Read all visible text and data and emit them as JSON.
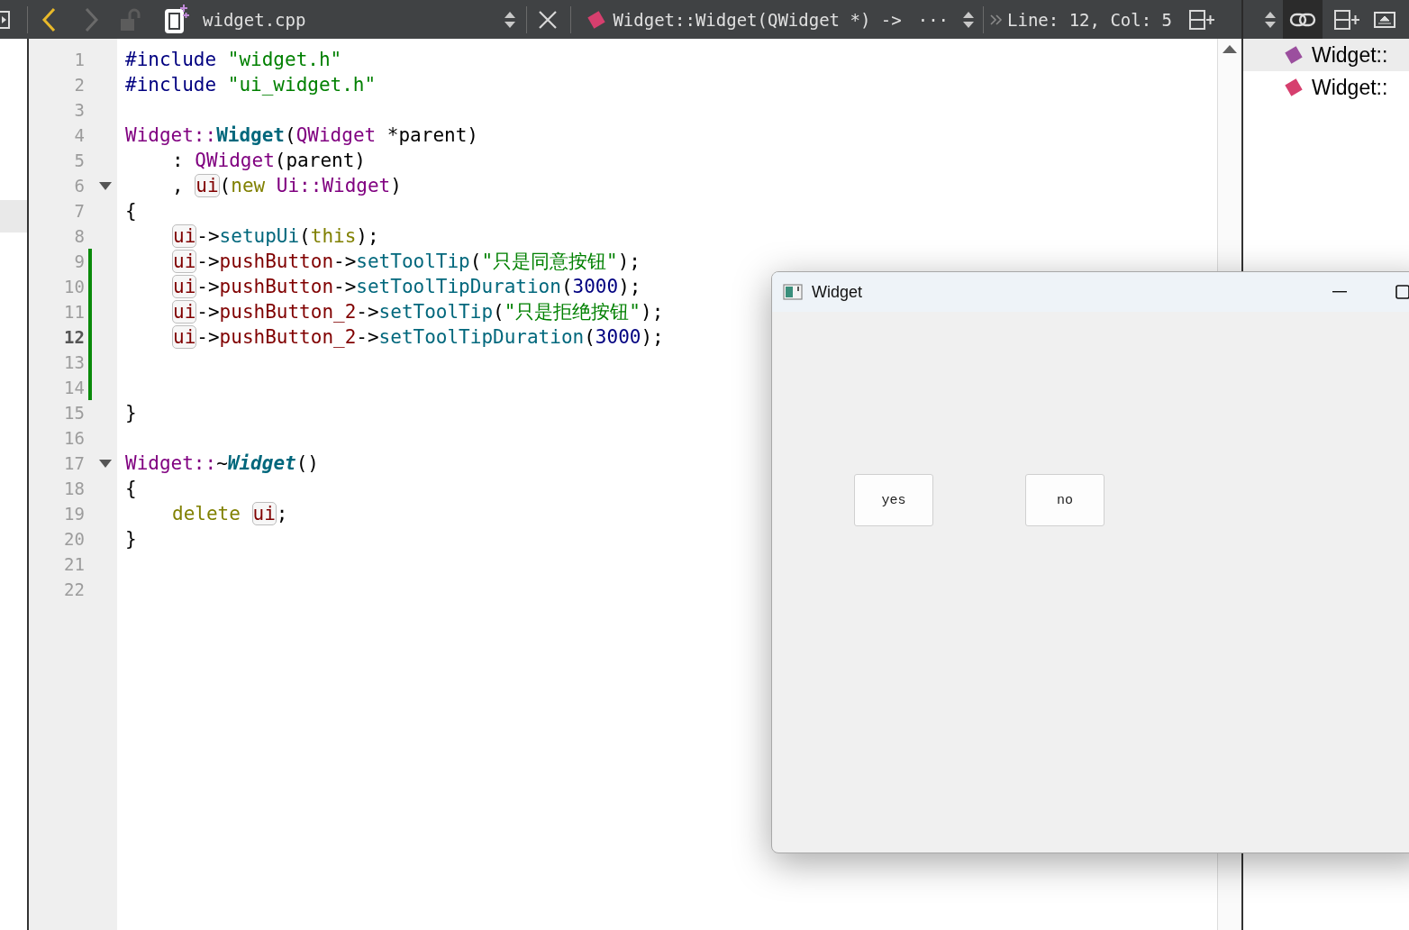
{
  "toolbar": {
    "back": {
      "disabled": false
    },
    "forward": {
      "disabled": true
    },
    "file_name": "widget.cpp",
    "symbol": "Widget::Widget(QWidget *) ->",
    "more": "···",
    "position": "Line: 12, Col: 5"
  },
  "outline_toolbar": {
    "link": {
      "selected": true
    }
  },
  "editor": {
    "lines": [
      {
        "number": "1",
        "current": false,
        "changed": false,
        "foldable": false,
        "tokens": [
          {
            "text": "#include ",
            "kind": "preproc"
          },
          {
            "text": "\"widget.h\"",
            "kind": "string"
          }
        ]
      },
      {
        "number": "2",
        "current": false,
        "changed": false,
        "foldable": false,
        "tokens": [
          {
            "text": "#include ",
            "kind": "preproc"
          },
          {
            "text": "\"ui_widget.h\"",
            "kind": "string"
          }
        ]
      },
      {
        "number": "3",
        "current": false,
        "changed": false,
        "foldable": false
      },
      {
        "number": "4",
        "current": false,
        "changed": false,
        "foldable": false,
        "tokens": [
          {
            "text": "Widget::",
            "kind": "type"
          },
          {
            "text": "Widget",
            "kind": "decl"
          },
          {
            "text": "(",
            "kind": "plain"
          },
          {
            "text": "QWidget",
            "kind": "type"
          },
          {
            "text": " *parent)",
            "kind": "plain"
          }
        ],
        "children": [
          {
            "number": "5",
            "current": false,
            "changed": false,
            "foldable": false,
            "tokens": [
              {
                "text": ": ",
                "kind": "plain"
              },
              {
                "text": "QWidget",
                "kind": "type"
              },
              {
                "text": "(parent)",
                "kind": "plain"
              }
            ]
          },
          {
            "number": "6",
            "current": false,
            "changed": false,
            "foldable": true,
            "tokens": [
              {
                "text": ", ",
                "kind": "plain"
              },
              {
                "text": "ui",
                "kind": "ref"
              },
              {
                "text": "(",
                "kind": "plain"
              },
              {
                "text": "new",
                "kind": "keyword"
              },
              {
                "text": " Ui::Widget",
                "kind": "type"
              },
              {
                "text": ")",
                "kind": "plain"
              }
            ]
          }
        ]
      },
      {
        "number": "7",
        "current": false,
        "changed": false,
        "foldable": false,
        "tokens": [
          {
            "text": "{",
            "kind": "plain"
          }
        ],
        "children": [
          {
            "number": "8",
            "current": false,
            "changed": false,
            "foldable": false,
            "tokens": [
              {
                "text": "ui",
                "kind": "ref"
              },
              {
                "text": "->",
                "kind": "plain"
              },
              {
                "text": "setupUi",
                "kind": "method"
              },
              {
                "text": "(",
                "kind": "plain"
              },
              {
                "text": "this",
                "kind": "keyword"
              },
              {
                "text": ");",
                "kind": "plain"
              }
            ]
          },
          {
            "number": "9",
            "current": false,
            "changed": true,
            "foldable": false,
            "tokens": [
              {
                "text": "ui",
                "kind": "ref"
              },
              {
                "text": "->",
                "kind": "plain"
              },
              {
                "text": "pushButton",
                "kind": "member"
              },
              {
                "text": "->",
                "kind": "plain"
              },
              {
                "text": "setToolTip",
                "kind": "method"
              },
              {
                "text": "(",
                "kind": "plain"
              },
              {
                "text": "\"只是同意按钮\"",
                "kind": "string"
              },
              {
                "text": ");",
                "kind": "plain"
              }
            ]
          },
          {
            "number": "10",
            "current": false,
            "changed": true,
            "foldable": false,
            "tokens": [
              {
                "text": "ui",
                "kind": "ref"
              },
              {
                "text": "->",
                "kind": "plain"
              },
              {
                "text": "pushButton",
                "kind": "member"
              },
              {
                "text": "->",
                "kind": "plain"
              },
              {
                "text": "setToolTipDuration",
                "kind": "method"
              },
              {
                "text": "(",
                "kind": "plain"
              },
              {
                "text": "3000",
                "kind": "number"
              },
              {
                "text": ");",
                "kind": "plain"
              }
            ]
          },
          {
            "number": "11",
            "current": false,
            "changed": true,
            "foldable": false,
            "tokens": [
              {
                "text": "ui",
                "kind": "ref"
              },
              {
                "text": "->",
                "kind": "plain"
              },
              {
                "text": "pushButton_2",
                "kind": "member"
              },
              {
                "text": "->",
                "kind": "plain"
              },
              {
                "text": "setToolTip",
                "kind": "method"
              },
              {
                "text": "(",
                "kind": "plain"
              },
              {
                "text": "\"只是拒绝按钮\"",
                "kind": "string"
              },
              {
                "text": ");",
                "kind": "plain"
              }
            ]
          },
          {
            "number": "12",
            "current": true,
            "changed": true,
            "foldable": false,
            "tokens": [
              {
                "text": "ui",
                "kind": "ref"
              },
              {
                "text": "->",
                "kind": "plain"
              },
              {
                "text": "pushButton_2",
                "kind": "member"
              },
              {
                "text": "->",
                "kind": "plain"
              },
              {
                "text": "setToolTipDuration",
                "kind": "method"
              },
              {
                "text": "(",
                "kind": "plain"
              },
              {
                "text": "3000",
                "kind": "number"
              },
              {
                "text": ");",
                "kind": "plain"
              }
            ]
          },
          {
            "number": "13",
            "current": false,
            "changed": true,
            "foldable": false
          },
          {
            "number": "14",
            "current": false,
            "changed": true,
            "foldable": false
          }
        ]
      },
      {
        "number": "15",
        "current": false,
        "changed": false,
        "foldable": false,
        "tokens": [
          {
            "text": "}",
            "kind": "plain"
          }
        ]
      },
      {
        "number": "16",
        "current": false,
        "changed": false,
        "foldable": false
      },
      {
        "number": "17",
        "current": false,
        "changed": false,
        "foldable": true,
        "tokens": [
          {
            "text": "Widget::",
            "kind": "type"
          },
          {
            "text": "~",
            "kind": "plain"
          },
          {
            "text": "Widget",
            "kind": "decl-italic"
          },
          {
            "text": "()",
            "kind": "plain"
          }
        ]
      },
      {
        "number": "18",
        "current": false,
        "changed": false,
        "foldable": false,
        "tokens": [
          {
            "text": "{",
            "kind": "plain"
          }
        ],
        "children": [
          {
            "number": "19",
            "current": false,
            "changed": false,
            "foldable": false,
            "tokens": [
              {
                "text": "delete ",
                "kind": "keyword"
              },
              {
                "text": "ui",
                "kind": "ref"
              },
              {
                "text": ";",
                "kind": "plain"
              }
            ]
          }
        ]
      },
      {
        "number": "20",
        "current": false,
        "changed": false,
        "foldable": false,
        "tokens": [
          {
            "text": "}",
            "kind": "plain"
          }
        ]
      },
      {
        "number": "21",
        "current": false,
        "changed": false,
        "foldable": false
      },
      {
        "number": "22",
        "current": false,
        "changed": false,
        "foldable": false
      }
    ]
  },
  "outline": {
    "items": [
      {
        "label": "Widget::",
        "color": "#9b4f9e",
        "selected": true
      },
      {
        "label": "Widget::",
        "color": "#d63f6e",
        "selected": false
      }
    ]
  },
  "app_window": {
    "title": "Widget",
    "buttons": [
      "yes",
      "no"
    ]
  }
}
